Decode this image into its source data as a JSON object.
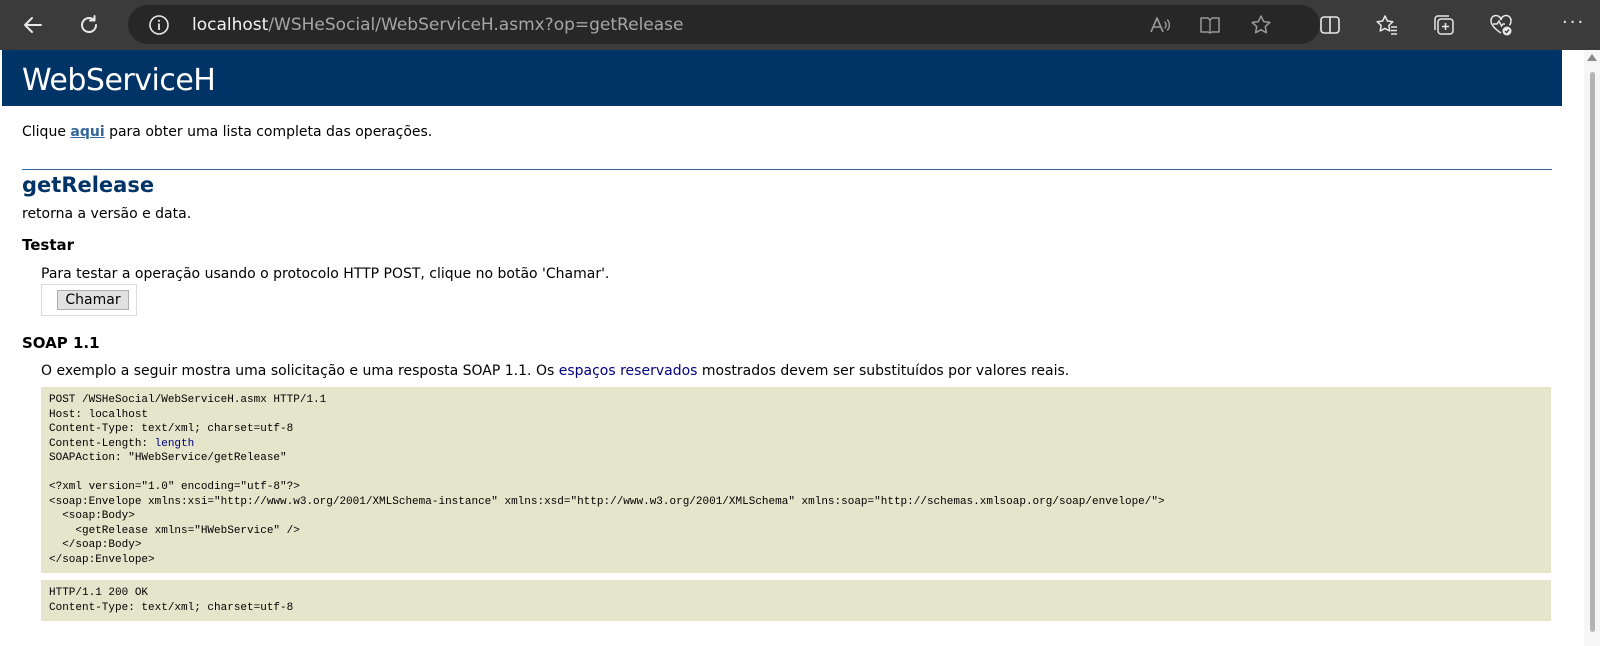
{
  "browser": {
    "url_host": "localhost",
    "url_path": "/WSHeSocial/WebServiceH.asmx?op=getRelease",
    "icons": [
      "back-icon",
      "refresh-icon",
      "site-info-icon",
      "read-aloud-icon",
      "immersive-reader-icon",
      "favorite-star-icon",
      "split-screen-icon",
      "favorites-icon",
      "collections-icon",
      "browser-essentials-icon",
      "more-icon"
    ],
    "more_label": "···"
  },
  "page": {
    "heading": "WebServiceH",
    "intro_before": "Clique ",
    "intro_link": "aqui",
    "intro_after": " para obter uma lista completa das operações.",
    "operation_title": "getRelease",
    "operation_desc": "retorna a versão e data.",
    "test_title": "Testar",
    "test_desc": "Para testar a operação usando o protocolo HTTP POST, clique no botão 'Chamar'.",
    "invoke_label": "Chamar",
    "soap_title": "SOAP 1.1",
    "soap_desc_before": "O exemplo a seguir mostra uma solicitação e uma resposta SOAP 1.1. Os ",
    "soap_desc_placeholder": "espaços reservados",
    "soap_desc_after": " mostrados devem ser substituídos por valores reais."
  },
  "request": {
    "line1": "POST /WSHeSocial/WebServiceH.asmx HTTP/1.1",
    "line2": "Host: localhost",
    "line3": "Content-Type: text/xml; charset=utf-8",
    "line4_label": "Content-Length: ",
    "line4_placeholder": "length",
    "line5": "SOAPAction: \"HWebService/getRelease\"",
    "line6": "",
    "line7": "<?xml version=\"1.0\" encoding=\"utf-8\"?>",
    "line8": "<soap:Envelope xmlns:xsi=\"http://www.w3.org/2001/XMLSchema-instance\" xmlns:xsd=\"http://www.w3.org/2001/XMLSchema\" xmlns:soap=\"http://schemas.xmlsoap.org/soap/envelope/\">",
    "line9": "  <soap:Body>",
    "line10": "    <getRelease xmlns=\"HWebService\" />",
    "line11": "  </soap:Body>",
    "line12": "</soap:Envelope>"
  },
  "response": {
    "line1": "HTTP/1.1 200 OK",
    "line2": "Content-Type: text/xml; charset=utf-8"
  }
}
